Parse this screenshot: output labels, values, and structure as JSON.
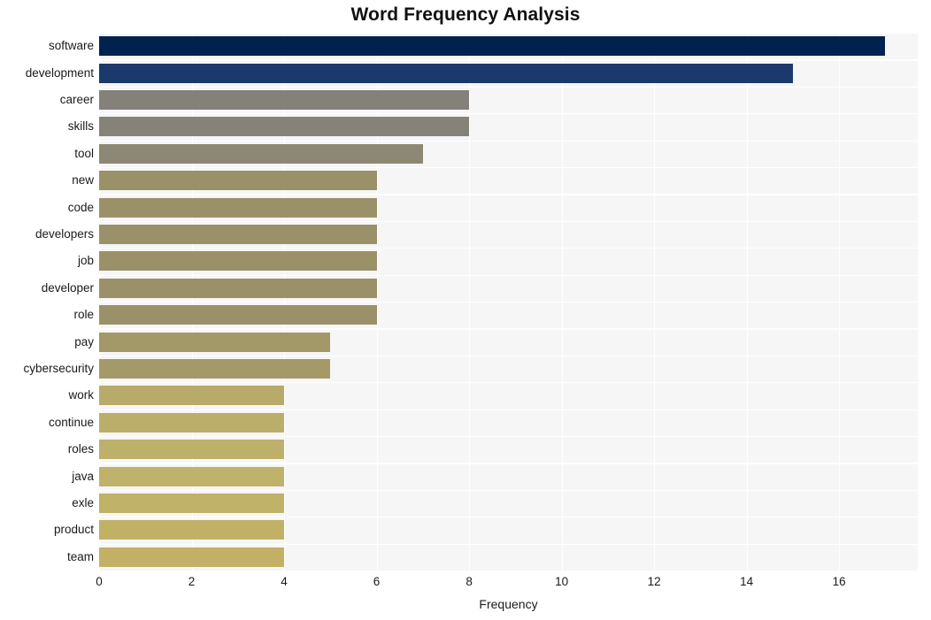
{
  "chart_data": {
    "type": "bar",
    "orientation": "horizontal",
    "title": "Word Frequency Analysis",
    "xlabel": "Frequency",
    "ylabel": "",
    "categories": [
      "software",
      "development",
      "career",
      "skills",
      "tool",
      "new",
      "code",
      "developers",
      "job",
      "developer",
      "role",
      "pay",
      "cybersecurity",
      "work",
      "continue",
      "roles",
      "java",
      "exle",
      "product",
      "team"
    ],
    "values": [
      17,
      15,
      8,
      8,
      7,
      6,
      6,
      6,
      6,
      6,
      6,
      5,
      5,
      4,
      4,
      4,
      4,
      4,
      4,
      4
    ],
    "bar_colors": [
      "#00224e",
      "#1b3a6b",
      "#84817b",
      "#858278",
      "#8d8873",
      "#9a9169",
      "#9a9169",
      "#9a9169",
      "#9a9169",
      "#9a9169",
      "#9a9169",
      "#a29868",
      "#a49a68",
      "#b8ab6a",
      "#bbae6a",
      "#bdb06a",
      "#bfb26a",
      "#c0b268",
      "#c1b167",
      "#c2b067"
    ],
    "xlim": [
      0,
      17.7
    ],
    "ylim_count": 20,
    "xticks": [
      0,
      2,
      4,
      6,
      8,
      10,
      12,
      14,
      16
    ],
    "xticklabels": [
      "0",
      "2",
      "4",
      "6",
      "8",
      "10",
      "12",
      "14",
      "16"
    ],
    "grid": true,
    "grid_color": "#ffffff",
    "plot_background": "#f6f6f7",
    "figure_background": "#ffffff",
    "legend": null
  }
}
